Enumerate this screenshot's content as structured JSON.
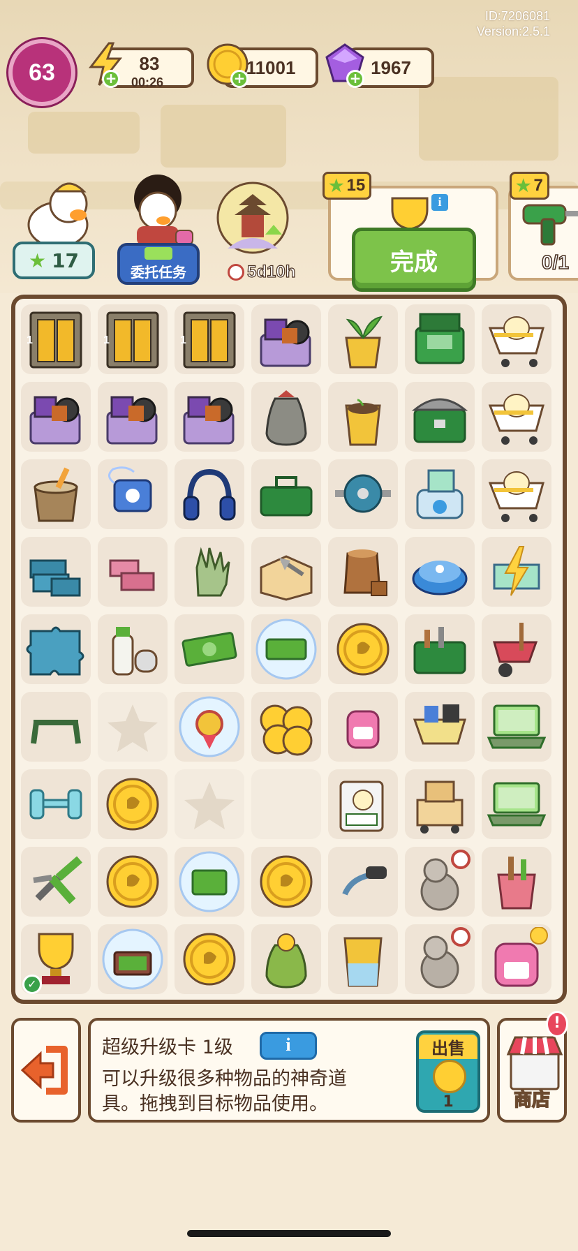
{
  "meta": {
    "id": "ID:7206081",
    "version": "Version:2.5.1"
  },
  "top_bar": {
    "level": "63",
    "energy": "83",
    "energy_timer": "00:26",
    "coins": "11001",
    "gems": "1967"
  },
  "characters": {
    "duck_stars": "17",
    "entrust_task_label": "委托任务",
    "event_timer": "5d10h"
  },
  "tasks": [
    {
      "reward_stars": "15",
      "button": "完成"
    },
    {
      "reward_stars": "7",
      "progress": "0/1"
    }
  ],
  "board": {
    "rows": [
      [
        "locker-1",
        "locker-1",
        "locker-1",
        "junk-pile",
        "sprout-pot",
        "green-toolbox-open",
        "duck-cart"
      ],
      [
        "junk-pile",
        "junk-pile",
        "junk-pile",
        "grey-sack",
        "soil-pot",
        "green-chest",
        "duck-cart"
      ],
      [
        "paint-bucket",
        "cassette-player",
        "headphones",
        "green-toolbox",
        "ab-roller",
        "3d-printer",
        "duck-cart"
      ],
      [
        "tile-stack",
        "bricks",
        "work-glove",
        "trowel-box",
        "stump",
        "robot-vacuum",
        "lightning-workbench"
      ],
      [
        "puzzle-pieces",
        "spray-can",
        "cash-bills",
        "bubble-cash",
        "gold-coin",
        "tool-bin",
        "wheelbarrow"
      ],
      [
        "bench",
        "empty-star",
        "bubble-medal",
        "coin-pile",
        "pink-backpack",
        "yellow-cart",
        "laptop"
      ],
      [
        "dumbbell",
        "gold-coin",
        "empty-star",
        "empty",
        "photo-card",
        "cart-boxes",
        "laptop"
      ],
      [
        "pruning-shears",
        "gold-coin",
        "bubble-money",
        "gold-coin",
        "hose-nozzle",
        "locked-statue",
        "tool-bucket"
      ],
      [
        "trophy",
        "bubble-briefcase",
        "gold-coin",
        "coin-sack",
        "empty-cup",
        "locked-statue",
        "pink-bag"
      ]
    ]
  },
  "info_panel": {
    "item_name": "超级升级卡 1级",
    "info_button": "i",
    "description": "可以升级很多种物品的神奇道具。拖拽到目标物品使用。",
    "sell_label": "出售",
    "sell_value": "1",
    "shop_label": "商店"
  },
  "colors": {
    "accent": "#6b4a2f",
    "green": "#7dc34a",
    "pink": "#b8327a",
    "gold": "#ffcf33"
  }
}
